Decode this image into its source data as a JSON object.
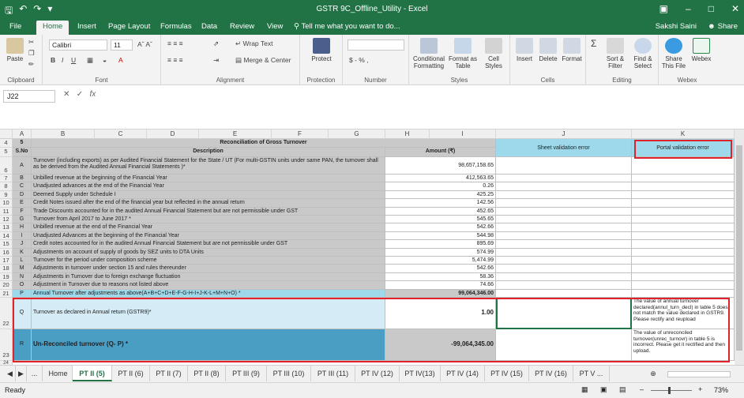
{
  "window": {
    "title": "GSTR 9C_Offline_Utility - Excel",
    "user": "Sakshi Saini",
    "share_label": "Share",
    "tell_me": "Tell me what you want to do..."
  },
  "ribbon_tabs": [
    "File",
    "Home",
    "Insert",
    "Page Layout",
    "Formulas",
    "Data",
    "Review",
    "View"
  ],
  "active_ribbon_tab": "Home",
  "ribbon": {
    "paste_label": "Paste",
    "clipboard_label": "Clipboard",
    "font_name": "Calibri",
    "font_size": "11",
    "font_label": "Font",
    "wrap_text": "Wrap Text",
    "merge_center": "Merge & Center",
    "alignment_label": "Alignment",
    "protect_label": "Protect",
    "protection_label": "Protection",
    "number_format": "$ - % ,",
    "number_label": "Number",
    "conditional_formatting": "Conditional Formatting",
    "format_as_table": "Format as Table",
    "cell_styles": "Cell Styles",
    "styles_label": "Styles",
    "insert": "Insert",
    "delete": "Delete",
    "format": "Format",
    "cells_label": "Cells",
    "sort_filter": "Sort & Filter",
    "find_select": "Find & Select",
    "editing_label": "Editing",
    "share_this_file": "Share This File",
    "webex": "Webex",
    "webex_label": "Webex"
  },
  "formula_bar": {
    "name_box": "J22",
    "fx": "fx",
    "value": ""
  },
  "columns": [
    "A",
    "B",
    "C",
    "D",
    "E",
    "F",
    "G",
    "H",
    "I",
    "J",
    "K"
  ],
  "sheet": {
    "title": "Reconciliation of Gross Turnover",
    "sno_header": "S.No",
    "desc_header": "Description",
    "amount_header": "Amount (₹)",
    "sheet_validation_header": "Sheet validation error",
    "portal_validation_header": "Portal validation error",
    "row4_label": "5",
    "rows": [
      {
        "row": "6",
        "sno": "A",
        "desc": "Turnover (including exports) as per Audited Financial Statement for the State / UT (For multi-GSTIN units under same PAN, the turnover shall as be derived from the Audited Annual Financial Statements )*",
        "amount": "98,657,158.65"
      },
      {
        "row": "7",
        "sno": "B",
        "desc": "Unbilled revenue at the beginning of the Financial Year",
        "amount": "412,563.65"
      },
      {
        "row": "8",
        "sno": "C",
        "desc": "Unadjusted advances at the end of the Financial Year",
        "amount": "0.26"
      },
      {
        "row": "9",
        "sno": "D",
        "desc": "Deemed Supply under Schedule I",
        "amount": "425.25"
      },
      {
        "row": "10",
        "sno": "E",
        "desc": "Credit Notes issued after the end of the financial year but reflected in the annual return",
        "amount": "142.56"
      },
      {
        "row": "11",
        "sno": "F",
        "desc": "Trade Discounts accounted for in the audited Annual Financial Statement but are not permissible under GST",
        "amount": "452.65"
      },
      {
        "row": "12",
        "sno": "G",
        "desc": "Turnover from April 2017 to June 2017 *",
        "amount": "545.65"
      },
      {
        "row": "13",
        "sno": "H",
        "desc": "Unbilled revenue at the end of the Financial Year",
        "amount": "542.66"
      },
      {
        "row": "14",
        "sno": "I",
        "desc": "Unadjusted Advances at the beginning of the Financial Year",
        "amount": "544.98"
      },
      {
        "row": "15",
        "sno": "J",
        "desc": "Credit notes accounted for in the audited Annual Financial Statement but are not permissible under GST",
        "amount": "895.69"
      },
      {
        "row": "16",
        "sno": "K",
        "desc": "Adjustments on account of supply of goods by SEZ units to DTA Units",
        "amount": "574.99"
      },
      {
        "row": "17",
        "sno": "L",
        "desc": "Turnover for the period under composition scheme",
        "amount": "5,474.99"
      },
      {
        "row": "18",
        "sno": "M",
        "desc": "Adjustments in turnover under section 15 and rules thereunder",
        "amount": "542.66"
      },
      {
        "row": "19",
        "sno": "N",
        "desc": "Adjustments in Turnover due to foreign exchange fluctuation",
        "amount": "58.36"
      },
      {
        "row": "20",
        "sno": "O",
        "desc": "Adjustment in Turnover due to reasons not listed above",
        "amount": "74.66"
      }
    ],
    "row21": {
      "row": "21",
      "sno": "P",
      "desc": "Annual Turnover after adjustments as above(A+B+C+D+E-F-G-H-I+J-K-L+M+N+O) *",
      "amount": "99,064,346.00"
    },
    "row22": {
      "row": "22",
      "sno": "Q",
      "desc": "Turnover as declared in Annual return (GSTR9)*",
      "amount": "1.00",
      "portal_error": "The value of annual turnover declared(annul_turn_decl) in table 5 does not match the value declared in GSTR9. Please rectify and reupload"
    },
    "row23": {
      "row": "23",
      "sno": "R",
      "desc": "Un-Reconciled turnover (Q- P) *",
      "amount": "-99,064,345.00",
      "portal_error": "The value of unreconciled turnover(unrec_turnovr) in table 5 is incorrect. Please get it rectified and then upload."
    },
    "row24": "24"
  },
  "sheet_tabs": [
    "Home",
    "PT II (5)",
    "PT II (6)",
    "PT II (7)",
    "PT II (8)",
    "PT III (9)",
    "PT III (10)",
    "PT III (11)",
    "PT IV (12)",
    "PT IV(13)",
    "PT IV (14)",
    "PT IV (15)",
    "PT IV (16)",
    "PT V ..."
  ],
  "active_sheet_tab": "PT II (5)",
  "status": {
    "ready": "Ready",
    "zoom": "73%"
  }
}
